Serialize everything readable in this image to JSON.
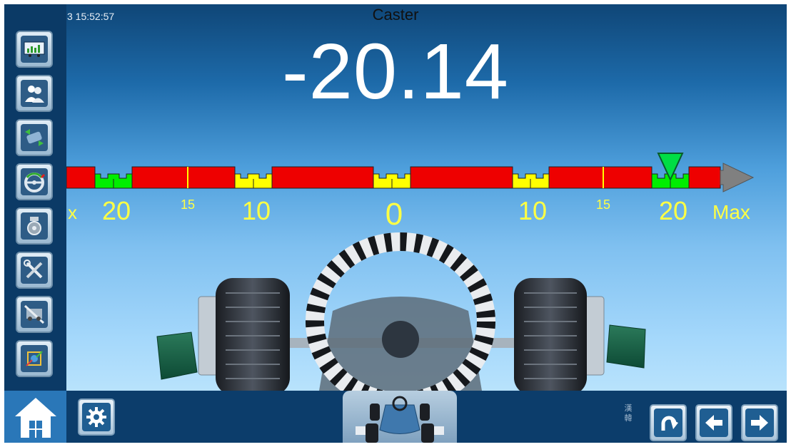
{
  "header": {
    "datetime": "3 15:52:57",
    "title": "Caster",
    "reading": "-20.14"
  },
  "scale": {
    "left_edge_label": "x",
    "max_label": "Max",
    "major_labels": [
      "20",
      "10",
      "0",
      "10",
      "20"
    ],
    "minor_labels": [
      "15",
      "15"
    ],
    "pointer_value": 20,
    "colors": {
      "red": "#ee0000",
      "yellow": "#ffff00",
      "green": "#00ee00",
      "label": "#ffff44",
      "arrow": "#808080"
    }
  },
  "sidebar": {
    "items": [
      {
        "icon": "vehicle-data-icon"
      },
      {
        "icon": "customers-icon"
      },
      {
        "icon": "wheel-runout-icon"
      },
      {
        "icon": "steering-wheel-icon"
      },
      {
        "icon": "brake-pedal-icon"
      },
      {
        "icon": "tools-icon"
      },
      {
        "icon": "calibration-icon"
      },
      {
        "icon": "graphics-icon"
      }
    ]
  },
  "bottom": {
    "language_glyphs": "漢\n韓",
    "buttons": [
      "home-icon",
      "gear-icon",
      "redo-icon",
      "arrow-left-icon",
      "arrow-right-icon"
    ]
  }
}
